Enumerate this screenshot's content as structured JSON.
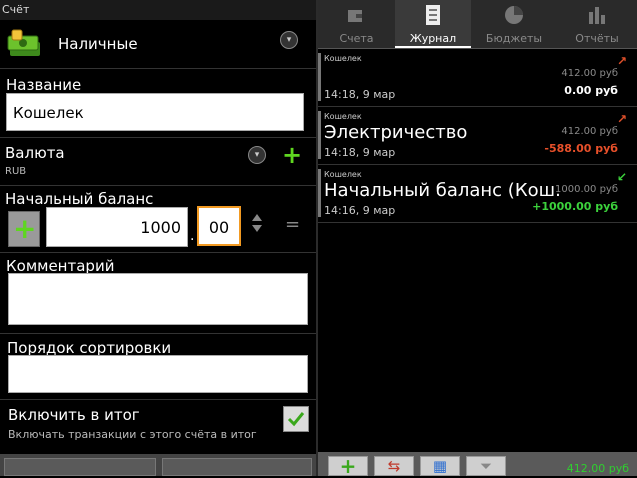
{
  "window": {
    "title": "Счёт"
  },
  "account": {
    "type": "Наличные"
  },
  "form": {
    "name_label": "Название",
    "name_value": "Кошелек",
    "currency_label": "Валюта",
    "currency_code": "RUB",
    "balance_label": "Начальный баланс",
    "balance_int": "1000",
    "balance_sep": ".",
    "balance_dec": "00",
    "equals": "=",
    "comment_label": "Комментарий",
    "sort_label": "Порядок сортировки",
    "include_label": "Включить в итог",
    "include_hint": "Включать транзакции с этого счёта в итог",
    "include_checked": true
  },
  "tabs": [
    {
      "label": "Счета",
      "icon": "wallet-icon",
      "active": false
    },
    {
      "label": "Журнал",
      "icon": "journal-icon",
      "active": true
    },
    {
      "label": "Бюджеты",
      "icon": "pie-chart-icon",
      "active": false
    },
    {
      "label": "Отчёты",
      "icon": "bar-chart-icon",
      "active": false
    }
  ],
  "transactions": [
    {
      "account": "Кошелек",
      "title": "",
      "time": "14:18, 9 мар",
      "balance": "412.00 руб",
      "amount": "0.00 руб",
      "amount_color": "#ffffff",
      "arrow_color": "#e0502a"
    },
    {
      "account": "Кошелек",
      "title": "Электричество",
      "time": "14:18, 9 мар",
      "balance": "412.00 руб",
      "amount": "-588.00 руб",
      "amount_color": "#e8502a",
      "arrow_color": "#e0502a"
    },
    {
      "account": "Кошелек",
      "title": "Начальный баланс (Кош.",
      "time": "14:16, 9 мар",
      "balance": "1000.00 руб",
      "amount": "+1000.00 руб",
      "amount_color": "#3cd23c",
      "arrow_color": "#3cd23c"
    }
  ],
  "footer": {
    "total": "412.00 руб"
  },
  "colors": {
    "accent_green": "#5fd620",
    "expense_red": "#e8502a",
    "income_green": "#3cd23c"
  }
}
